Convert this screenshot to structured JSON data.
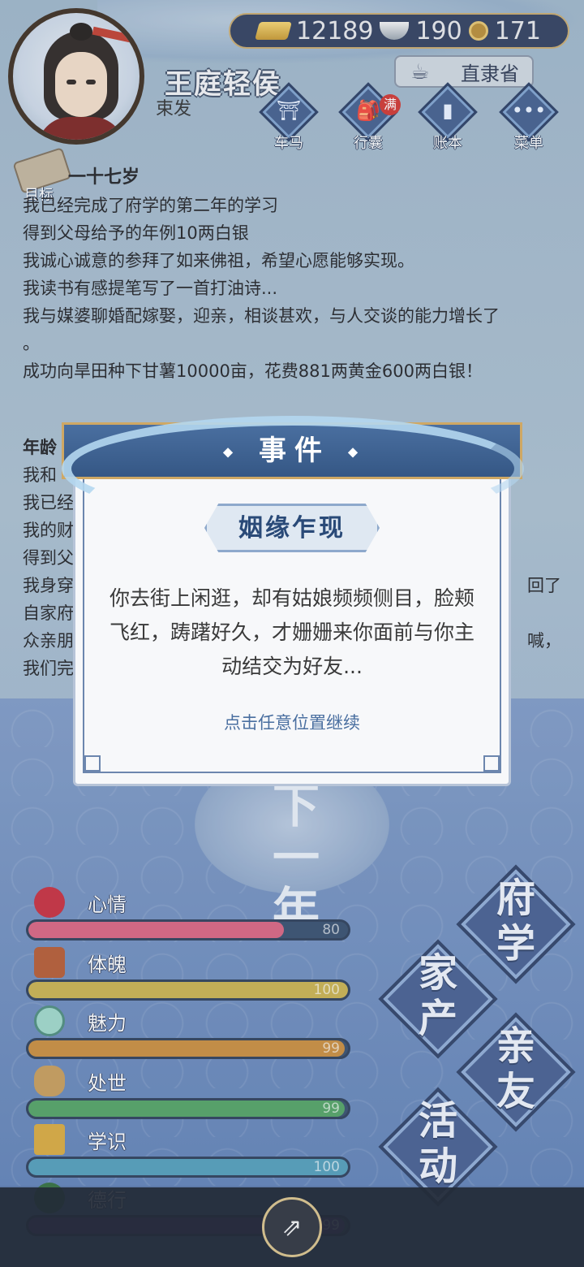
{
  "header": {
    "player_name": "王庭轻侯",
    "player_title": "束发",
    "currency": {
      "gold": "12189",
      "silver": "190",
      "copper": "171"
    },
    "province": "直隶省"
  },
  "nav": [
    {
      "label": "车马",
      "icon": "carriage-icon"
    },
    {
      "label": "行囊",
      "icon": "bag-icon",
      "badge": "满"
    },
    {
      "label": "账本",
      "icon": "ledger-icon"
    },
    {
      "label": "菜单",
      "icon": "menu-icon"
    }
  ],
  "goal_label": "目标",
  "log": {
    "age": "一十七岁",
    "lines": [
      "我已经完成了府学的第二年的学习",
      "得到父母给予的年例10两白银",
      "我诚心诚意的参拜了如来佛祖，希望心愿能够实现。",
      "我读书有感提笔写了一首打油诗...",
      "我与媒婆聊婚配嫁娶，迎亲，相谈甚欢，与人交谈的能力增长了",
      "。",
      "成功向旱田种下甘薯10000亩，花费881两黄金600两白银！"
    ]
  },
  "log2": {
    "age": "年龄",
    "lines": [
      "我和",
      "我已经",
      "我的财",
      "得到父",
      "我身穿",
      "自家府",
      "众亲朋",
      "我们完"
    ],
    "right_fragments": [
      "回了",
      "喊，"
    ]
  },
  "next_year": "下一年",
  "stats": [
    {
      "name": "心情",
      "value": "80",
      "level": 0.8,
      "color": "#d9607e"
    },
    {
      "name": "体魄",
      "value": "100",
      "level": 1.0,
      "color": "#c9b04a"
    },
    {
      "name": "魅力",
      "value": "99",
      "level": 0.99,
      "color": "#c98a38"
    },
    {
      "name": "处世",
      "value": "99",
      "level": 0.99,
      "color": "#4fa060"
    },
    {
      "name": "学识",
      "value": "100",
      "level": 1.0,
      "color": "#4f9bb8"
    },
    {
      "name": "德行",
      "value": "99",
      "level": 0.99,
      "color": "#6a3a8a"
    }
  ],
  "actions": [
    "府学",
    "家产",
    "亲友",
    "活动"
  ],
  "dialog": {
    "header": "事件",
    "subtitle": "姻缘乍现",
    "body": "你去街上闲逛，却有姑娘频频侧目，脸颊飞红，踌躇好久，才姗姗来你面前与你主动结交为好友...",
    "hint": "点击任意位置继续"
  }
}
